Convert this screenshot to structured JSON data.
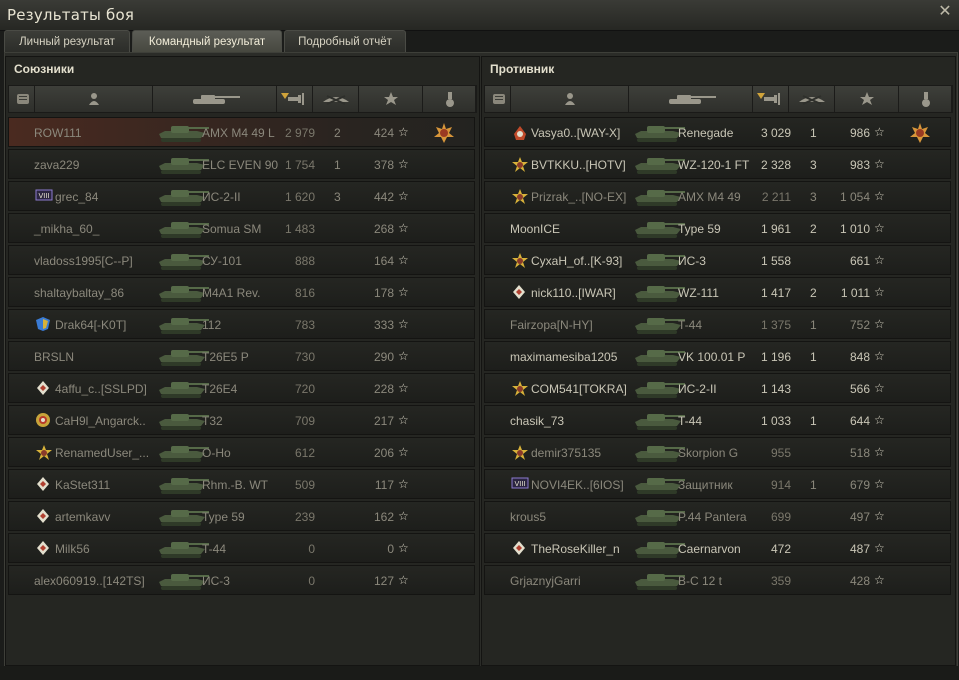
{
  "window": {
    "title": "Результаты боя",
    "close_glyph": "✕"
  },
  "tabs": [
    {
      "label": "Личный результат",
      "active": false
    },
    {
      "label": "Командный результат",
      "active": true
    },
    {
      "label": "Подробный отчёт",
      "active": false
    }
  ],
  "allies": {
    "title": "Союзники",
    "rows": [
      {
        "player": "ROW111",
        "tank": "AMX M4 49 L",
        "damage": "2 979",
        "kills": "2",
        "xp": "424",
        "badge": "medal",
        "me": true,
        "dead": true
      },
      {
        "player": "zava229",
        "tank": "ELC EVEN 90",
        "damage": "1 754",
        "kills": "1",
        "xp": "378",
        "dead": true
      },
      {
        "player": "grec_84",
        "tank": "ИС-2-II",
        "damage": "1 620",
        "kills": "3",
        "xp": "442",
        "icon": "viii",
        "dead": true
      },
      {
        "player": "_mikha_60_",
        "tank": "Somua SM",
        "damage": "1 483",
        "kills": "",
        "xp": "268",
        "dead": true
      },
      {
        "player": "vladoss1995[C--P]",
        "tank": "СУ-101",
        "damage": "888",
        "kills": "",
        "xp": "164",
        "dead": true
      },
      {
        "player": "shaltaybaltay_86",
        "tank": "M4A1 Rev.",
        "damage": "816",
        "kills": "",
        "xp": "178",
        "dead": true
      },
      {
        "player": "Drak64[-K0T]",
        "tank": "112",
        "damage": "783",
        "kills": "",
        "xp": "333",
        "icon": "clan-shield",
        "dead": true
      },
      {
        "player": "BRSLN",
        "tank": "T26E5 P",
        "damage": "730",
        "kills": "",
        "xp": "290",
        "dead": true
      },
      {
        "player": "4affu_c..[SSLPD]",
        "tank": "T26E4",
        "damage": "720",
        "kills": "",
        "xp": "228",
        "icon": "rank",
        "dead": true
      },
      {
        "player": "CaH9l_Angarck..",
        "tank": "T32",
        "damage": "709",
        "kills": "",
        "xp": "217",
        "icon": "target",
        "dead": true
      },
      {
        "player": "RenamedUser_...",
        "tank": "O-Ho",
        "damage": "612",
        "kills": "",
        "xp": "206",
        "icon": "star",
        "dead": true
      },
      {
        "player": "KaStet311",
        "tank": "Rhm.-B. WT",
        "damage": "509",
        "kills": "",
        "xp": "117",
        "icon": "rank",
        "dead": true
      },
      {
        "player": "artemkavv",
        "tank": "Type 59",
        "damage": "239",
        "kills": "",
        "xp": "162",
        "icon": "rank",
        "dead": true
      },
      {
        "player": "Milk56",
        "tank": "T-44",
        "damage": "0",
        "kills": "",
        "xp": "0",
        "icon": "rank",
        "dead": true
      },
      {
        "player": "alex060919..[142TS]",
        "tank": "ИС-3",
        "damage": "0",
        "kills": "",
        "xp": "127",
        "dead": true
      }
    ]
  },
  "enemies": {
    "title": "Противник",
    "rows": [
      {
        "player": "Vasya0..[WAY-X]",
        "tank": "Renegade",
        "damage": "3 029",
        "kills": "1",
        "xp": "986",
        "badge": "medal",
        "icon": "skull"
      },
      {
        "player": "BVTKKU..[HOTV]",
        "tank": "WZ-120-1 FT",
        "damage": "2 328",
        "kills": "3",
        "xp": "983",
        "icon": "star"
      },
      {
        "player": "Prizrak_..[NO-EX]",
        "tank": "AMX M4 49",
        "damage": "2 211",
        "kills": "3",
        "xp": "1 054",
        "icon": "star",
        "dead": true
      },
      {
        "player": "MoonICE",
        "tank": "Type 59",
        "damage": "1 961",
        "kills": "2",
        "xp": "1 010"
      },
      {
        "player": "CyxaH_of..[K-93]",
        "tank": "ИС-3",
        "damage": "1 558",
        "kills": "",
        "xp": "661",
        "icon": "star"
      },
      {
        "player": "nick110..[IWAR]",
        "tank": "WZ-111",
        "damage": "1 417",
        "kills": "2",
        "xp": "1 011",
        "icon": "rank"
      },
      {
        "player": "Fairzopa[N-HY]",
        "tank": "T-44",
        "damage": "1 375",
        "kills": "1",
        "xp": "752",
        "dead": true
      },
      {
        "player": "maximamesiba1205",
        "tank": "VK 100.01 P",
        "damage": "1 196",
        "kills": "1",
        "xp": "848"
      },
      {
        "player": "COM541[TOKRA]",
        "tank": "ИС-2-II",
        "damage": "1 143",
        "kills": "",
        "xp": "566",
        "icon": "star"
      },
      {
        "player": "chasik_73",
        "tank": "T-44",
        "damage": "1 033",
        "kills": "1",
        "xp": "644"
      },
      {
        "player": "demir375135",
        "tank": "Skorpion G",
        "damage": "955",
        "kills": "",
        "xp": "518",
        "icon": "star",
        "dead": true
      },
      {
        "player": "NOVI4EK..[6IOS]",
        "tank": "Защитник",
        "damage": "914",
        "kills": "1",
        "xp": "679",
        "icon": "viii",
        "dead": true
      },
      {
        "player": "krous5",
        "tank": "P.44 Pantera",
        "damage": "699",
        "kills": "",
        "xp": "497",
        "dead": true
      },
      {
        "player": "TheRoseKiller_n",
        "tank": "Caernarvon",
        "damage": "472",
        "kills": "",
        "xp": "487",
        "icon": "rank"
      },
      {
        "player": "GrjaznyjGarri",
        "tank": "B-C 12 t",
        "damage": "359",
        "kills": "",
        "xp": "428",
        "dead": true
      }
    ]
  },
  "colors": {
    "accent_me": "#4a2a20",
    "text": "#c9c6b6",
    "text_dead": "#8b887c"
  }
}
